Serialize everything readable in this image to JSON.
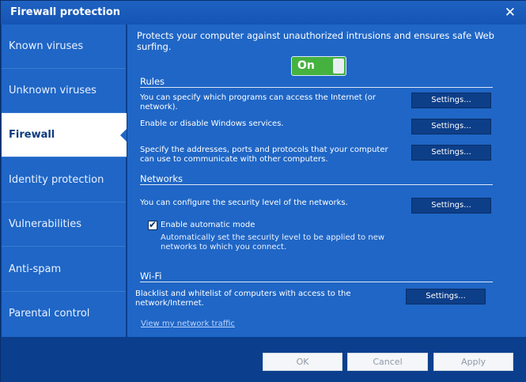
{
  "window": {
    "title": "Firewall protection"
  },
  "sidebar": {
    "items": [
      {
        "label": "Known viruses"
      },
      {
        "label": "Unknown viruses"
      },
      {
        "label": "Firewall"
      },
      {
        "label": "Identity protection"
      },
      {
        "label": "Vulnerabilities"
      },
      {
        "label": "Anti-spam"
      },
      {
        "label": "Parental control"
      }
    ],
    "active_index": 2
  },
  "main": {
    "description": "Protects your computer against unauthorized intrusions and ensures safe Web surfing.",
    "toggle": {
      "label": "On",
      "state": "on",
      "color": "#45b23f"
    },
    "rules": {
      "title": "Rules",
      "rows": [
        {
          "text": "You can specify which programs can access the Internet (or network).",
          "button": "Settings..."
        },
        {
          "text": "Enable or disable Windows services.",
          "button": "Settings..."
        },
        {
          "text": "Specify the addresses, ports and protocols that your computer can use to communicate with other computers.",
          "button": "Settings..."
        }
      ]
    },
    "networks": {
      "title": "Networks",
      "row": {
        "text": "You can configure the security level of the networks.",
        "button": "Settings..."
      },
      "auto_mode": {
        "label": "Enable automatic mode",
        "checked": true,
        "description": "Automatically set the security level to be applied to new networks to which you connect."
      }
    },
    "wifi": {
      "title": "Wi-Fi",
      "row": {
        "text": "Blacklist and whitelist of computers with access to the network/Internet.",
        "button": "Settings..."
      }
    },
    "link": "View my network traffic"
  },
  "footer": {
    "ok": "OK",
    "cancel": "Cancel",
    "apply": "Apply"
  },
  "colors": {
    "panel": "#1f66c6",
    "dark": "#0b3f8e",
    "accent_green": "#45b23f"
  }
}
